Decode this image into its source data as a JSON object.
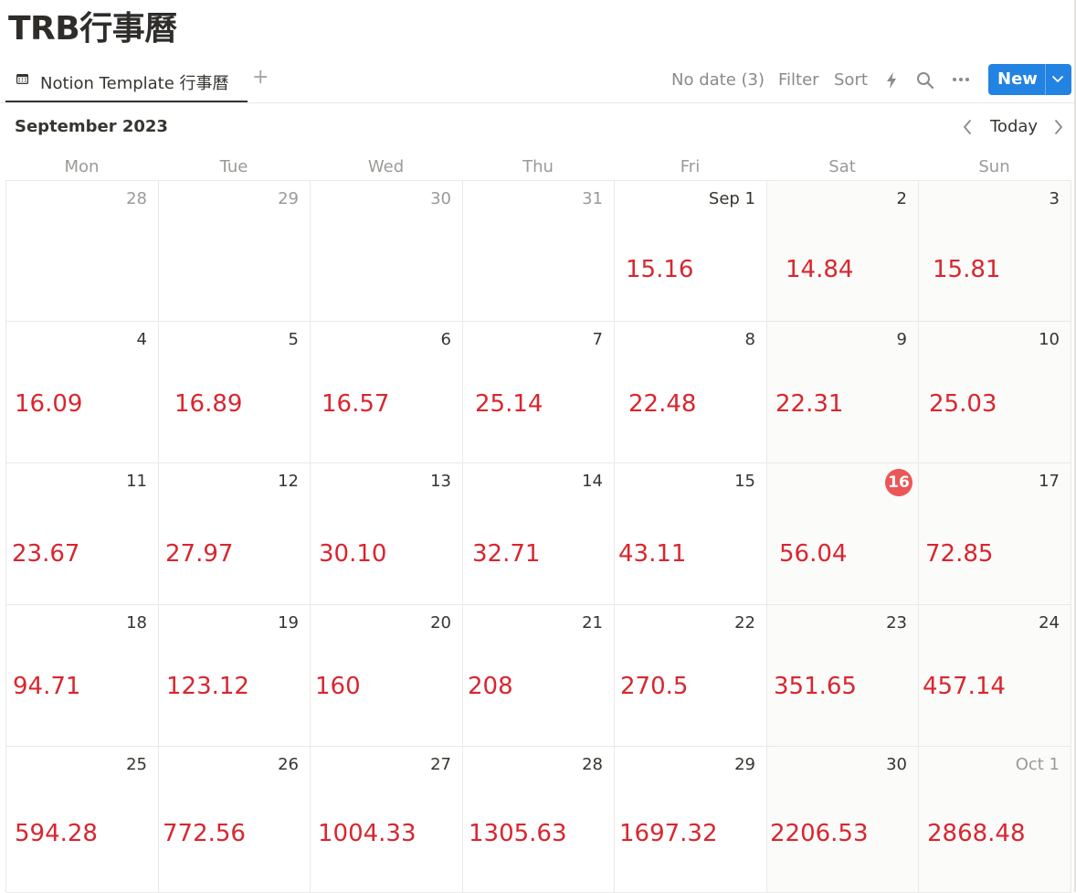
{
  "page": {
    "title": "TRB行事曆"
  },
  "view_bar": {
    "tab_label": "Notion Template 行事曆",
    "tab_icon": "calendar-icon",
    "add_icon": "plus-icon",
    "no_date": "No date (3)",
    "filter": "Filter",
    "sort": "Sort",
    "automation_icon": "lightning-icon",
    "search_icon": "search-icon",
    "more_icon": "more-icon",
    "new_label": "New",
    "new_chevron_icon": "chevron-down-icon"
  },
  "calendar": {
    "month_label": "September 2023",
    "today_label": "Today",
    "prev_icon": "chevron-left-icon",
    "next_icon": "chevron-right-icon",
    "weekdays": [
      "Mon",
      "Tue",
      "Wed",
      "Thu",
      "Fri",
      "Sat",
      "Sun"
    ],
    "weeks": [
      [
        {
          "date": "28",
          "muted": true,
          "event": ""
        },
        {
          "date": "29",
          "muted": true,
          "event": ""
        },
        {
          "date": "30",
          "muted": true,
          "event": ""
        },
        {
          "date": "31",
          "muted": true,
          "event": ""
        },
        {
          "date": "Sep 1",
          "event": "15.16"
        },
        {
          "date": "2",
          "event": "14.84"
        },
        {
          "date": "3",
          "event": "15.81"
        }
      ],
      [
        {
          "date": "4",
          "event": "16.09"
        },
        {
          "date": "5",
          "event": "16.89"
        },
        {
          "date": "6",
          "event": "16.57"
        },
        {
          "date": "7",
          "event": "25.14"
        },
        {
          "date": "8",
          "event": "22.48"
        },
        {
          "date": "9",
          "event": "22.31"
        },
        {
          "date": "10",
          "event": "25.03"
        }
      ],
      [
        {
          "date": "11",
          "event": "23.67"
        },
        {
          "date": "12",
          "event": "27.97"
        },
        {
          "date": "13",
          "event": "30.10"
        },
        {
          "date": "14",
          "event": "32.71"
        },
        {
          "date": "15",
          "event": "43.11"
        },
        {
          "date": "16",
          "today": true,
          "event": "56.04"
        },
        {
          "date": "17",
          "event": "72.85"
        }
      ],
      [
        {
          "date": "18",
          "event": "94.71"
        },
        {
          "date": "19",
          "event": "123.12"
        },
        {
          "date": "20",
          "event": "160"
        },
        {
          "date": "21",
          "event": "208"
        },
        {
          "date": "22",
          "event": "270.5"
        },
        {
          "date": "23",
          "event": "351.65"
        },
        {
          "date": "24",
          "event": "457.14"
        }
      ],
      [
        {
          "date": "25",
          "event": "594.28"
        },
        {
          "date": "26",
          "event": "772.56"
        },
        {
          "date": "27",
          "event": "1004.33"
        },
        {
          "date": "28",
          "event": "1305.63"
        },
        {
          "date": "29",
          "event": "1697.32"
        },
        {
          "date": "30",
          "event": "2206.53"
        },
        {
          "date": "Oct 1",
          "muted": true,
          "event": "2868.48"
        }
      ]
    ]
  },
  "colors": {
    "accent": "#2383e2",
    "event_text": "#d9262f",
    "today_badge": "#eb5757"
  }
}
